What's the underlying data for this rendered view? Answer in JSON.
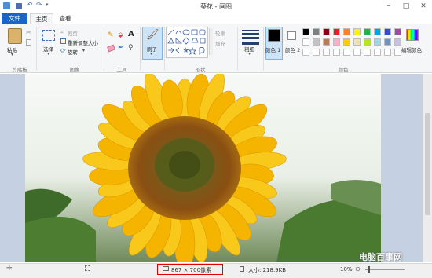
{
  "window": {
    "title": "葵花 - 画图",
    "minimize": "–",
    "maximize": "□",
    "close": "✕"
  },
  "tabs": {
    "file": "文件",
    "home": "主页",
    "view": "查看"
  },
  "clipboard": {
    "paste": "粘贴",
    "cut": "剪切",
    "copy": "复制",
    "group": "剪贴板"
  },
  "image": {
    "select": "选择",
    "crop": "裁剪",
    "resize": "重新调整大小",
    "rotate": "旋转",
    "group": "图像"
  },
  "tools": {
    "text": "A",
    "group": "工具"
  },
  "shapes": {
    "brush": "刷子",
    "outline": "轮廓",
    "fill": "填充",
    "group": "形状"
  },
  "size": {
    "label": "粗细"
  },
  "colors": {
    "color1": "颜色 1",
    "color2": "颜色 2",
    "edit": "编辑颜色",
    "group": "颜色",
    "palette_row1": [
      "#000000",
      "#7f7f7f",
      "#880015",
      "#ed1c24",
      "#ff7f27",
      "#fff200",
      "#22b14c",
      "#00a2e8",
      "#3f48cc",
      "#a349a4"
    ],
    "palette_row2": [
      "#ffffff",
      "#c3c3c3",
      "#b97a57",
      "#ffaec9",
      "#ffc90e",
      "#efe4b0",
      "#b5e61d",
      "#99d9ea",
      "#7092be",
      "#c8bfe7"
    ]
  },
  "status": {
    "dimensions": "867 × 700像素",
    "size": "大小: 218.9KB",
    "zoom": "10%",
    "watermark": "电脑百事网"
  }
}
